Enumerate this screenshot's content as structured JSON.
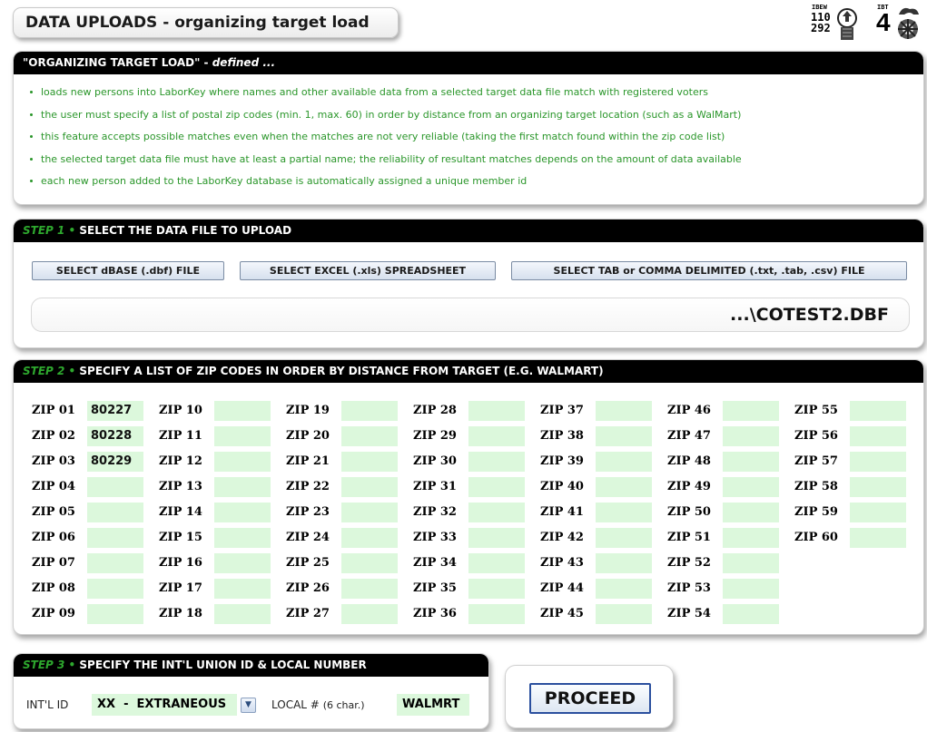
{
  "header": {
    "title_main": "DATA UPLOADS",
    "title_sep": " - ",
    "title_sub": "organizing target load"
  },
  "logos": {
    "ibew": {
      "label": "IBEW",
      "line1": "110",
      "line2": "292",
      "icon": "fist-lightning-icon"
    },
    "ibt": {
      "label": "IBT",
      "number": "4",
      "icon": "horse-wheel-icon"
    }
  },
  "definition": {
    "heading": "\"ORGANIZING TARGET LOAD\"",
    "heading_sep": " - ",
    "heading_suffix": "defined ...",
    "bullets": [
      "loads new persons into LaborKey where names and other available data from a selected target data file match with registered voters",
      "the user must specify a list of postal zip codes (min. 1, max. 60) in order by distance from an organizing target location (such as a WalMart)",
      "this feature accepts possible matches even when the matches are not very reliable (taking the first match found within the zip code list)",
      "the selected target data file must have at least a partial name; the reliability of resultant matches depends on the amount of data available",
      "each new person added to the LaborKey database is automatically assigned a unique member id"
    ]
  },
  "step1": {
    "step_label": "STEP 1",
    "dot": "•",
    "title": "SELECT THE DATA FILE TO UPLOAD",
    "buttons": [
      "SELECT dBASE (.dbf) FILE",
      "SELECT EXCEL (.xls) SPREADSHEET",
      "SELECT TAB or COMMA DELIMITED (.txt, .tab, .csv) FILE"
    ],
    "file_path": "...\\COTEST2.DBF"
  },
  "step2": {
    "step_label": "STEP 2",
    "dot": "•",
    "title": "SPECIFY A LIST OF ZIP CODES IN ORDER BY DISTANCE FROM TARGET (E.G. WALMART)",
    "zips": [
      {
        "label": "ZIP 01",
        "value": "80227"
      },
      {
        "label": "ZIP 02",
        "value": "80228"
      },
      {
        "label": "ZIP 03",
        "value": "80229"
      },
      {
        "label": "ZIP 04",
        "value": ""
      },
      {
        "label": "ZIP 05",
        "value": ""
      },
      {
        "label": "ZIP 06",
        "value": ""
      },
      {
        "label": "ZIP 07",
        "value": ""
      },
      {
        "label": "ZIP 08",
        "value": ""
      },
      {
        "label": "ZIP 09",
        "value": ""
      },
      {
        "label": "ZIP 10",
        "value": ""
      },
      {
        "label": "ZIP 11",
        "value": ""
      },
      {
        "label": "ZIP 12",
        "value": ""
      },
      {
        "label": "ZIP 13",
        "value": ""
      },
      {
        "label": "ZIP 14",
        "value": ""
      },
      {
        "label": "ZIP 15",
        "value": ""
      },
      {
        "label": "ZIP 16",
        "value": ""
      },
      {
        "label": "ZIP 17",
        "value": ""
      },
      {
        "label": "ZIP 18",
        "value": ""
      },
      {
        "label": "ZIP 19",
        "value": ""
      },
      {
        "label": "ZIP 20",
        "value": ""
      },
      {
        "label": "ZIP 21",
        "value": ""
      },
      {
        "label": "ZIP 22",
        "value": ""
      },
      {
        "label": "ZIP 23",
        "value": ""
      },
      {
        "label": "ZIP 24",
        "value": ""
      },
      {
        "label": "ZIP 25",
        "value": ""
      },
      {
        "label": "ZIP 26",
        "value": ""
      },
      {
        "label": "ZIP 27",
        "value": ""
      },
      {
        "label": "ZIP 28",
        "value": ""
      },
      {
        "label": "ZIP 29",
        "value": ""
      },
      {
        "label": "ZIP 30",
        "value": ""
      },
      {
        "label": "ZIP 31",
        "value": ""
      },
      {
        "label": "ZIP 32",
        "value": ""
      },
      {
        "label": "ZIP 33",
        "value": ""
      },
      {
        "label": "ZIP 34",
        "value": ""
      },
      {
        "label": "ZIP 35",
        "value": ""
      },
      {
        "label": "ZIP 36",
        "value": ""
      },
      {
        "label": "ZIP 37",
        "value": ""
      },
      {
        "label": "ZIP 38",
        "value": ""
      },
      {
        "label": "ZIP 39",
        "value": ""
      },
      {
        "label": "ZIP 40",
        "value": ""
      },
      {
        "label": "ZIP 41",
        "value": ""
      },
      {
        "label": "ZIP 42",
        "value": ""
      },
      {
        "label": "ZIP 43",
        "value": ""
      },
      {
        "label": "ZIP 44",
        "value": ""
      },
      {
        "label": "ZIP 45",
        "value": ""
      },
      {
        "label": "ZIP 46",
        "value": ""
      },
      {
        "label": "ZIP 47",
        "value": ""
      },
      {
        "label": "ZIP 48",
        "value": ""
      },
      {
        "label": "ZIP 49",
        "value": ""
      },
      {
        "label": "ZIP 50",
        "value": ""
      },
      {
        "label": "ZIP 51",
        "value": ""
      },
      {
        "label": "ZIP 52",
        "value": ""
      },
      {
        "label": "ZIP 53",
        "value": ""
      },
      {
        "label": "ZIP 54",
        "value": ""
      },
      {
        "label": "ZIP 55",
        "value": ""
      },
      {
        "label": "ZIP 56",
        "value": ""
      },
      {
        "label": "ZIP 57",
        "value": ""
      },
      {
        "label": "ZIP 58",
        "value": ""
      },
      {
        "label": "ZIP 59",
        "value": ""
      },
      {
        "label": "ZIP 60",
        "value": ""
      }
    ]
  },
  "step3": {
    "step_label": "STEP 3",
    "dot": "•",
    "title": "SPECIFY THE INT'L UNION ID & LOCAL NUMBER",
    "intl_label": "INT'L ID",
    "intl_value": "XX  -  EXTRANEOUS",
    "dropdown_icon": "chevron-down-icon",
    "local_label": "LOCAL #",
    "local_hint": "(6 char.)",
    "local_value": "WALMRT"
  },
  "proceed": {
    "label": "PROCEED"
  },
  "colors": {
    "green_text": "#2a962a",
    "step_green": "#2ea82e",
    "input_green": "#dcf8dc",
    "header_black": "#000000",
    "button_border": "#2a4f9e"
  }
}
